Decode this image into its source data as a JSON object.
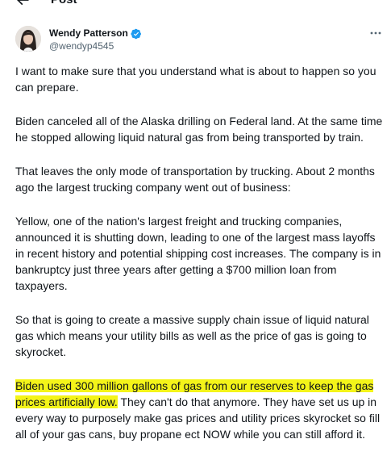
{
  "header": {
    "title": "Post"
  },
  "author": {
    "name": "Wendy Patterson",
    "handle": "@wendyp4545"
  },
  "post": {
    "p1": "I want to make sure that you understand what is about to happen so you can prepare.",
    "p2": "Biden canceled all of the Alaska drilling on Federal land.  At the same time he stopped allowing liquid natural gas from being transported by train.",
    "p3": "That leaves the only mode of transportation by trucking.  About 2 months ago the largest trucking company went out of business:",
    "p4": "Yellow, one of the nation's largest freight and trucking companies, announced it is shutting down, leading to one of the largest mass layoffs in recent history and potential shipping cost increases. The company is in bankruptcy just three years after getting a $700 million loan from taxpayers.",
    "p5": "So that is going to create a massive supply chain issue of liquid natural gas which means your utility bills as well as the price of gas is going to skyrocket.",
    "p6_highlight": "Biden used 300 million gallons of gas from our reserves to keep the gas prices artificially low.",
    "p6_rest": "  They can't do that anymore.  They have set us up in every way to purposely make gas prices and utility prices skyrocket so fill all of your gas cans, buy propane ect NOW while you can still afford it."
  },
  "colors": {
    "highlight": "#f4f419",
    "verified": "#1d9bf0",
    "text": "#0f1419",
    "secondary": "#536471"
  },
  "icons": {
    "back": "back-arrow-icon",
    "verified": "verified-badge-icon",
    "more": "more-options-icon"
  }
}
